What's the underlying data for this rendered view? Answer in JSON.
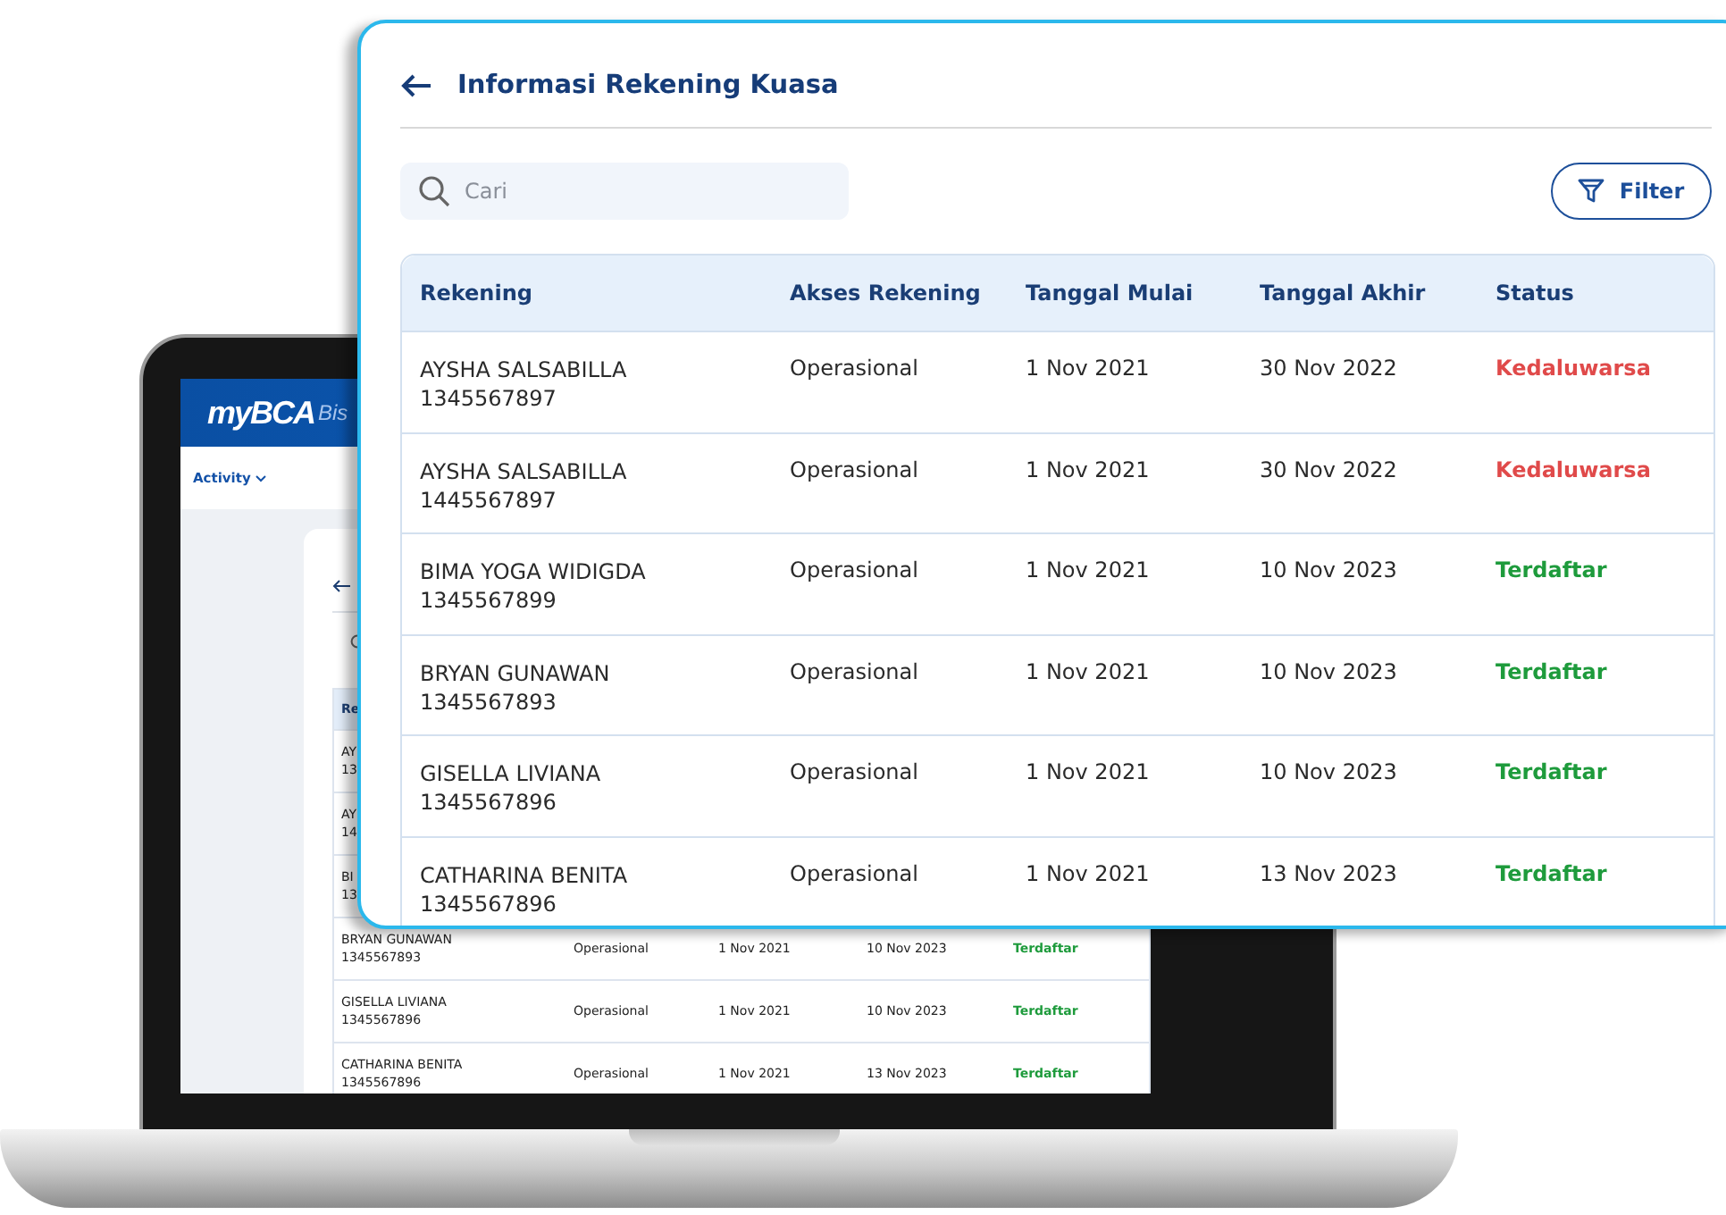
{
  "laptop": {
    "brand": "myBCA",
    "brand_suffix": "Bis",
    "nav": "Activity",
    "table": {
      "header": "Re",
      "rows": [
        {
          "name": "AY",
          "number": "13"
        },
        {
          "name": "AY",
          "number": "14"
        },
        {
          "name": "BI",
          "number": "13"
        },
        {
          "name": "BRYAN GUNAWAN",
          "number": "1345567893",
          "access": "Operasional",
          "start": "1 Nov 2021",
          "end": "10 Nov 2023",
          "status": "Terdaftar",
          "kind": "registered"
        },
        {
          "name": "GISELLA LIVIANA",
          "number": "1345567896",
          "access": "Operasional",
          "start": "1 Nov 2021",
          "end": "10 Nov 2023",
          "status": "Terdaftar",
          "kind": "registered"
        },
        {
          "name": "CATHARINA BENITA",
          "number": "1345567896",
          "access": "Operasional",
          "start": "1 Nov 2021",
          "end": "13 Nov 2023",
          "status": "Terdaftar",
          "kind": "registered"
        }
      ]
    }
  },
  "panel": {
    "title": "Informasi Rekening Kuasa",
    "search": {
      "placeholder": "Cari"
    },
    "filter_button": "Filter",
    "table": {
      "columns": [
        "Rekening",
        "Akses Rekening",
        "Tanggal Mulai",
        "Tanggal Akhir",
        "Status"
      ],
      "rows": [
        {
          "name": "AYSHA SALSABILLA",
          "number": "1345567897",
          "access": "Operasional",
          "start": "1 Nov 2021",
          "end": "30 Nov 2022",
          "status": "Kedaluwarsa",
          "kind": "expired"
        },
        {
          "name": "AYSHA SALSABILLA",
          "number": "1445567897",
          "access": "Operasional",
          "start": "1 Nov 2021",
          "end": "30 Nov 2022",
          "status": "Kedaluwarsa",
          "kind": "expired"
        },
        {
          "name": "BIMA YOGA WIDIGDA",
          "number": "1345567899",
          "access": "Operasional",
          "start": "1 Nov 2021",
          "end": "10 Nov 2023",
          "status": "Terdaftar",
          "kind": "registered"
        },
        {
          "name": "BRYAN GUNAWAN",
          "number": "1345567893",
          "access": "Operasional",
          "start": "1 Nov 2021",
          "end": "10 Nov 2023",
          "status": "Terdaftar",
          "kind": "registered"
        },
        {
          "name": "GISELLA LIVIANA",
          "number": "1345567896",
          "access": "Operasional",
          "start": "1 Nov 2021",
          "end": "10 Nov 2023",
          "status": "Terdaftar",
          "kind": "registered"
        },
        {
          "name": "CATHARINA BENITA",
          "number": "1345567896",
          "access": "Operasional",
          "start": "1 Nov 2021",
          "end": "13 Nov 2023",
          "status": "Terdaftar",
          "kind": "registered"
        }
      ]
    }
  }
}
